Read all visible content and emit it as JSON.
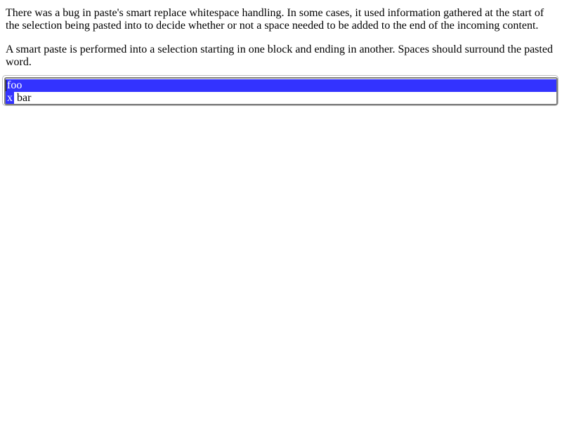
{
  "description": {
    "paragraph_1": "There was a bug in paste's smart replace whitespace handling. In some cases, it used information gathered at the start of the selection being pasted into to decide whether or not a space needed to be added to the end of the incoming content.",
    "paragraph_2": "A smart paste is performed into a selection starting in one block and ending in another. Spaces should surround the pasted word."
  },
  "editor": {
    "line_1": "foo",
    "line_2_selected": "x",
    "line_2_rest": " bar"
  },
  "colors": {
    "selection": "#3333ff",
    "selection_text": "#ffffff",
    "border": "#7d7d7d"
  }
}
